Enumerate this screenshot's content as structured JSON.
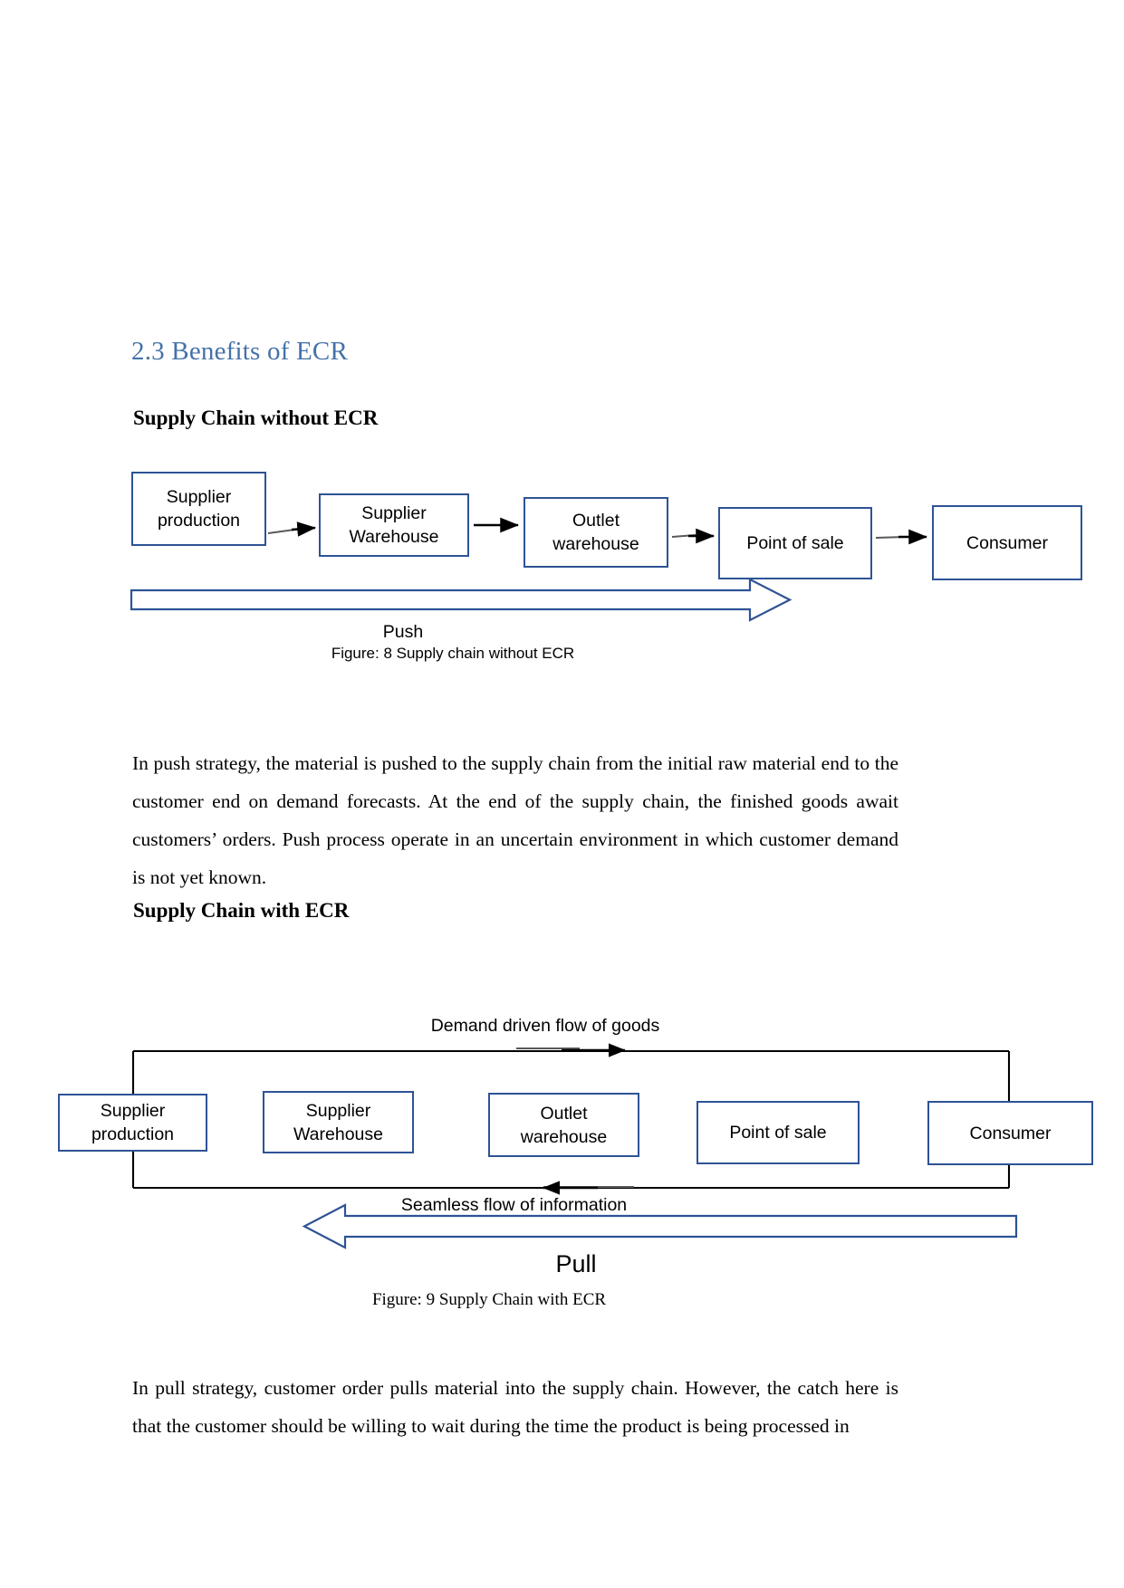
{
  "document": {
    "section_heading": "2.3 Benefits of ECR",
    "subheading_without": "Supply Chain without ECR",
    "subheading_with": "Supply Chain with ECR",
    "paragraph_push": "In push strategy, the material is pushed to the supply chain from the initial raw material end to the customer end on demand forecasts. At the end of the supply chain, the finished goods await customers’ orders. Push process operate in an uncertain environment in which customer demand is not yet known.",
    "paragraph_pull": "In pull strategy, customer order pulls material into the supply chain. However, the catch here is that the customer should be willing to wait during the time the product is being processed in"
  },
  "colors": {
    "heading_blue": "#4472a8",
    "box_border_blue": "#2e5395",
    "arrow_black": "#000000",
    "block_arrow_blue": "#2e5395",
    "page_background": "#ffffff"
  },
  "figure_without_ecr": {
    "caption": "Figure: 8 Supply chain without ECR",
    "flow_label": "Push",
    "nodes": [
      {
        "label": "Supplier\nproduction"
      },
      {
        "label": "Supplier\nWarehouse"
      },
      {
        "label": "Outlet\nwarehouse"
      },
      {
        "label": "Point of sale"
      },
      {
        "label": "Consumer"
      }
    ],
    "connector_count": 4,
    "connector_direction": "left-to-right"
  },
  "figure_with_ecr": {
    "caption": "Figure: 9 Supply Chain with ECR",
    "top_flow_label": "Demand driven flow of goods",
    "bottom_flow_label": "Seamless flow of information",
    "block_arrow_label": "Pull",
    "nodes": [
      {
        "label": "Supplier\nproduction"
      },
      {
        "label": "Supplier\nWarehouse"
      },
      {
        "label": "Outlet\nwarehouse"
      },
      {
        "label": "Point of sale"
      },
      {
        "label": "Consumer"
      }
    ],
    "top_flow_direction": "left-to-right",
    "bottom_flow_direction": "right-to-left",
    "block_arrow_direction": "right-to-left"
  }
}
